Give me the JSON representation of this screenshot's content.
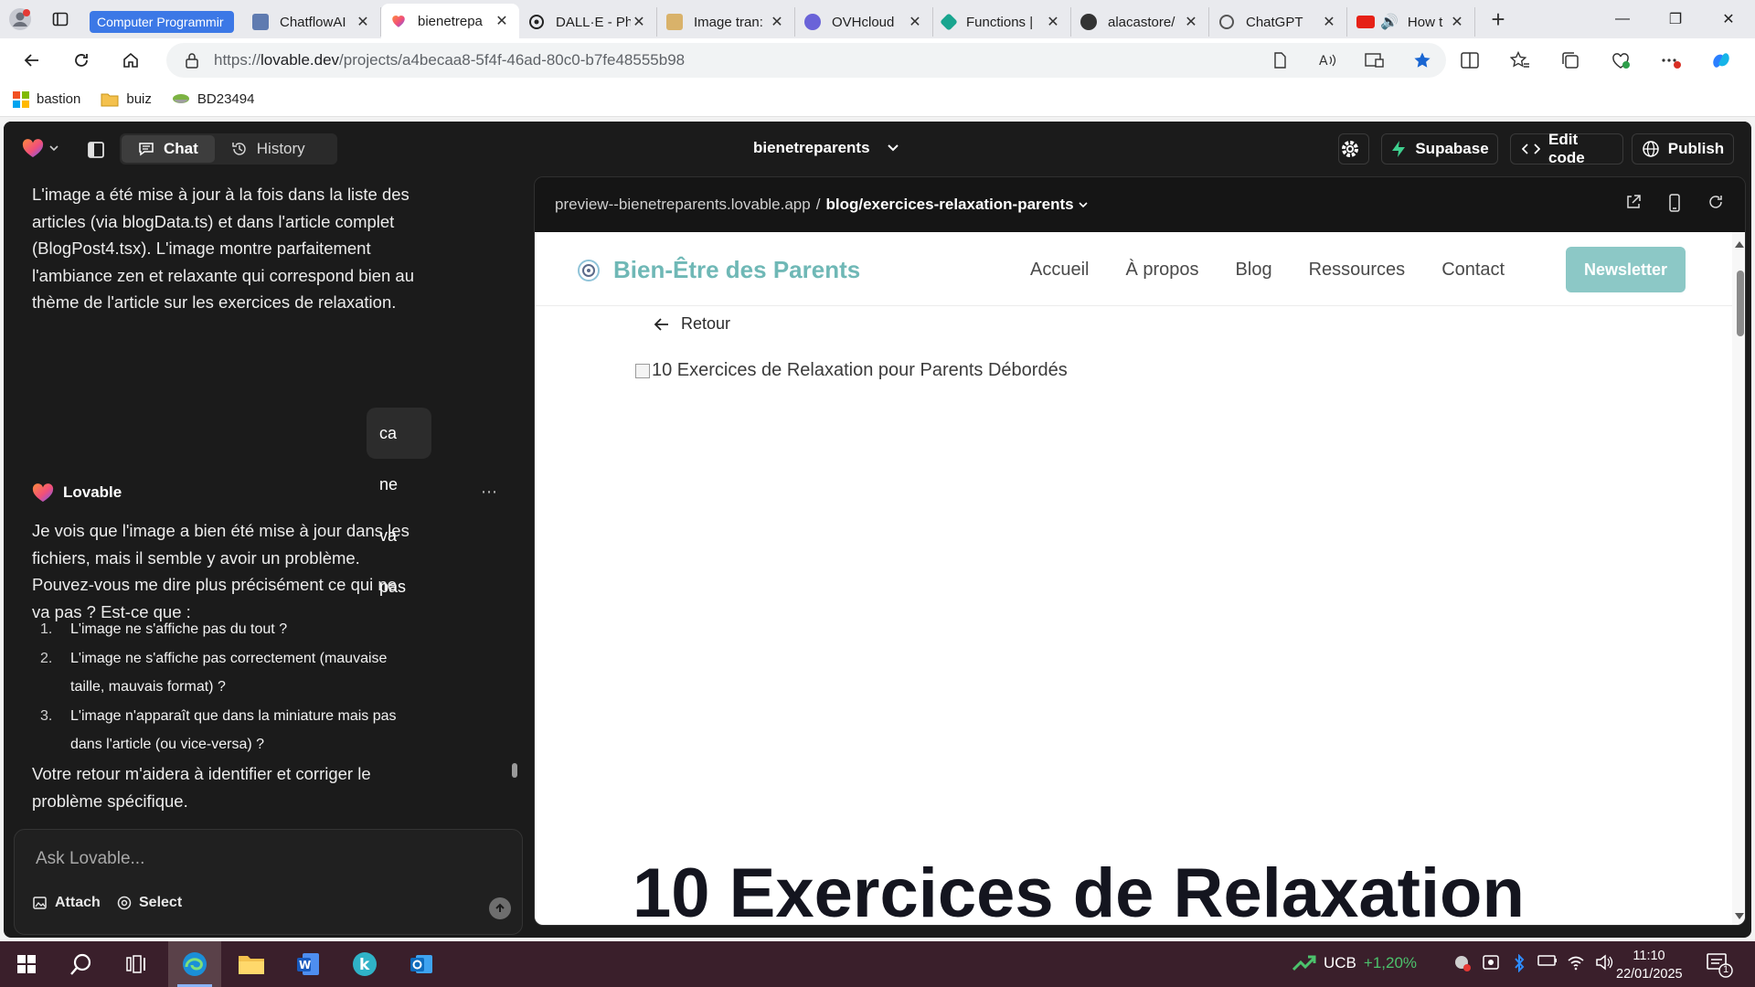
{
  "browser": {
    "tab_group_label": "Computer Programmir",
    "tabs": [
      {
        "title": "ChatflowAI",
        "color": "#5f7bb0"
      },
      {
        "title": "bienetrepa",
        "color": "#f06d3a"
      },
      {
        "title": "DALL·E - Ph",
        "color": "#222222"
      },
      {
        "title": "Image tran:",
        "color": "#d9b26a"
      },
      {
        "title": "OVHcloud",
        "color": "#6a63d8"
      },
      {
        "title": "Functions |",
        "color": "#19a58f"
      },
      {
        "title": "alacastore/",
        "color": "#333333"
      },
      {
        "title": "ChatGPT",
        "color": "#444444"
      },
      {
        "title": "How t",
        "color": "#e62117"
      }
    ],
    "url_prefix": "https://",
    "url_domain": "lovable.dev",
    "url_path": "/projects/a4becaa8-5f4f-46ad-80c0-b7fe48555b98",
    "bookmarks": [
      {
        "label": "bastion",
        "icon": "windows-icon"
      },
      {
        "label": "buiz",
        "icon": "folder-icon"
      },
      {
        "label": "BD23494",
        "icon": "bowl-icon"
      }
    ]
  },
  "app": {
    "tabs": {
      "chat": "Chat",
      "history": "History"
    },
    "project_name": "bienetreparents",
    "buttons": {
      "supabase": "Supabase",
      "edit_code": "Edit code",
      "publish": "Publish"
    }
  },
  "chat": {
    "msg1": "L'image a été mise à jour à la fois dans la liste des articles (via blogData.ts) et dans l'article complet (BlogPost4.tsx). L'image montre parfaitement l'ambiance zen et relaxante qui correspond bien au thème de l'article sur les exercices de relaxation.",
    "user_msg": "ca ne va pas",
    "assistant_name": "Lovable",
    "msg2": "Je vois que l'image a bien été mise à jour dans les fichiers, mais il semble y avoir un problème. Pouvez-vous me dire plus précisément ce qui ne va pas ? Est-ce que :",
    "list": [
      "L'image ne s'affiche pas du tout ?",
      "L'image ne s'affiche pas correctement (mauvaise taille, mauvais format) ?",
      "L'image n'apparaît que dans la miniature mais pas dans l'article (ou vice-versa) ?"
    ],
    "msg3": "Votre retour m'aidera à identifier et corriger le problème spécifique.",
    "input_placeholder": "Ask Lovable...",
    "attach_label": "Attach",
    "select_label": "Select"
  },
  "preview": {
    "domain": "preview--bienetreparents.lovable.app",
    "separator": "/",
    "path": "blog/exercices-relaxation-parents",
    "site": {
      "brand": "Bien-Être des Parents",
      "nav": [
        "Accueil",
        "À propos",
        "Blog",
        "Ressources",
        "Contact"
      ],
      "newsletter": "Newsletter",
      "back": "Retour",
      "image_alt": "10 Exercices de Relaxation pour Parents Débordés",
      "title": "10 Exercices de Relaxation"
    }
  },
  "taskbar": {
    "ticker_symbol": "UCB",
    "ticker_change": "+1,20%",
    "time": "11:10",
    "date": "22/01/2025",
    "notifications": "1"
  }
}
